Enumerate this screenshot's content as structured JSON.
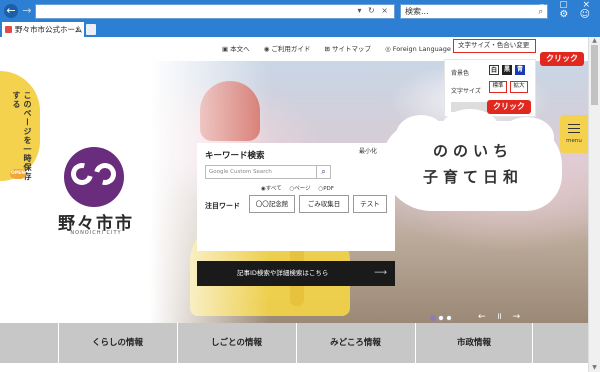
{
  "browser": {
    "address_controls": "▾ ↻ ×",
    "search_placeholder": "検索...",
    "tab_title": "野々市市公式ホームページ",
    "tab_close": "×"
  },
  "utility_nav": [
    {
      "icon": "▣",
      "label": "本文へ"
    },
    {
      "icon": "◉",
      "label": "ご利用ガイド"
    },
    {
      "icon": "⊞",
      "label": "サイトマップ"
    },
    {
      "icon": "◎",
      "label": "Foreign Language"
    }
  ],
  "size_color_button": "文字サイズ・色合い変更",
  "callouts": [
    "クリック",
    "クリック"
  ],
  "settings": {
    "bg_label": "背景色",
    "bg_options": [
      "白",
      "黒",
      "青"
    ],
    "size_label": "文字サイズ",
    "size_options": [
      "標準",
      "拡大"
    ]
  },
  "side_tab": {
    "text": "このページを一時保存する",
    "open": "OPEN"
  },
  "menu_label": "menu",
  "logo": {
    "name": "野々市市",
    "romaji": "NONOICHI CITY"
  },
  "search": {
    "title": "キーワード検索",
    "shrink": "最小化",
    "placeholder": "Google Custom Search",
    "radios": [
      "◉すべて",
      "○ページ",
      "○PDF"
    ],
    "attention_label": "注目ワード",
    "chips": [
      "〇〇記念館",
      "ごみ収集日",
      "テスト"
    ],
    "advanced": "記事ID検索や詳細検索はこちら"
  },
  "slogan": [
    "ののいち",
    "子育て日和"
  ],
  "slider_controls": "← ॥ →",
  "main_menu": [
    "くらしの情報",
    "しごとの情報",
    "みどころ情報",
    "市政情報"
  ],
  "colors": {
    "accent": "#e0281e",
    "logo": "#6a2c7c",
    "yellow": "#f4d24e"
  }
}
